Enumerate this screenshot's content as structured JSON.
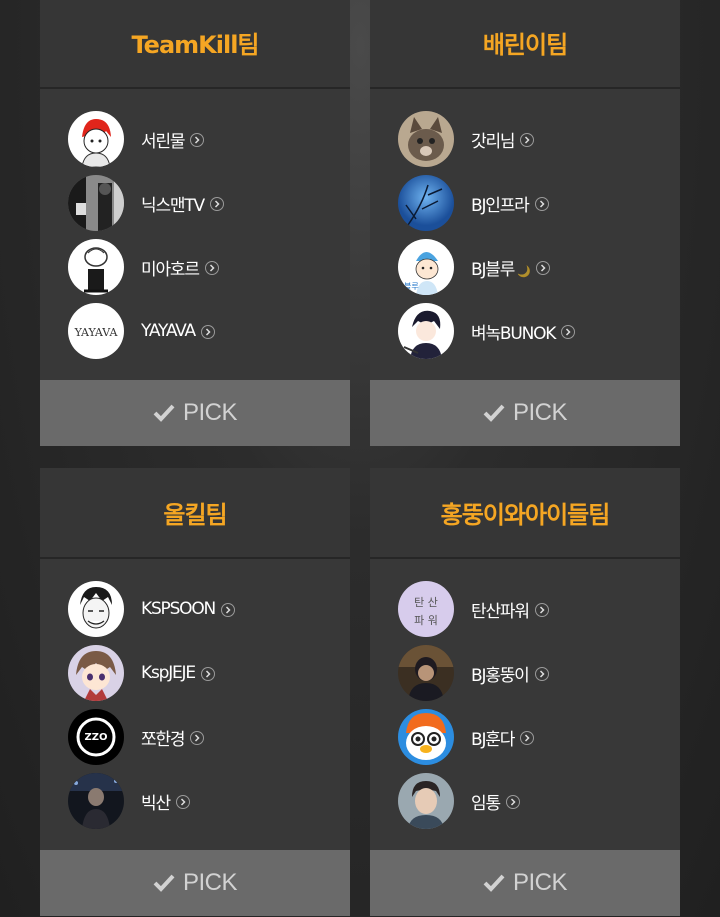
{
  "pick_label": "PICK",
  "accent_color": "#f5a623",
  "teams": [
    {
      "name": "TeamKill팀",
      "members": [
        {
          "name": "서린물",
          "avatar": "red-hair-cartoon"
        },
        {
          "name": "닉스맨TV",
          "avatar": "bw-photo"
        },
        {
          "name": "미아호르",
          "avatar": "sketch-figure"
        },
        {
          "name": "YAYAVA",
          "avatar": "yayava-text-logo",
          "avatar_text": "YAYAVA"
        }
      ]
    },
    {
      "name": "배린이팀",
      "members": [
        {
          "name": "갓리님",
          "avatar": "cat-photo"
        },
        {
          "name": "BJ인프라",
          "avatar": "blue-sky-branches"
        },
        {
          "name": "BJ블루",
          "avatar": "blue-cap-cartoon",
          "suffix": "🌙"
        },
        {
          "name": "벼녹BUNOK",
          "avatar": "anime-boy"
        }
      ]
    },
    {
      "name": "올킬팀",
      "members": [
        {
          "name": "KSPSOON",
          "avatar": "sketch-face"
        },
        {
          "name": "KspJEJE",
          "avatar": "anime-face"
        },
        {
          "name": "쪼한경",
          "avatar": "zzo-tube-logo",
          "avatar_text": "ZZO"
        },
        {
          "name": "빅산",
          "avatar": "dark-photo"
        }
      ]
    },
    {
      "name": "홍뚱이와아이들팀",
      "members": [
        {
          "name": "탄산파워",
          "avatar": "text-tile",
          "avatar_text": "탄 산 파 워"
        },
        {
          "name": "BJ홍뚱이",
          "avatar": "person-photo"
        },
        {
          "name": "BJ훈다",
          "avatar": "pororo-character"
        },
        {
          "name": "임통",
          "avatar": "person-portrait"
        }
      ]
    }
  ]
}
